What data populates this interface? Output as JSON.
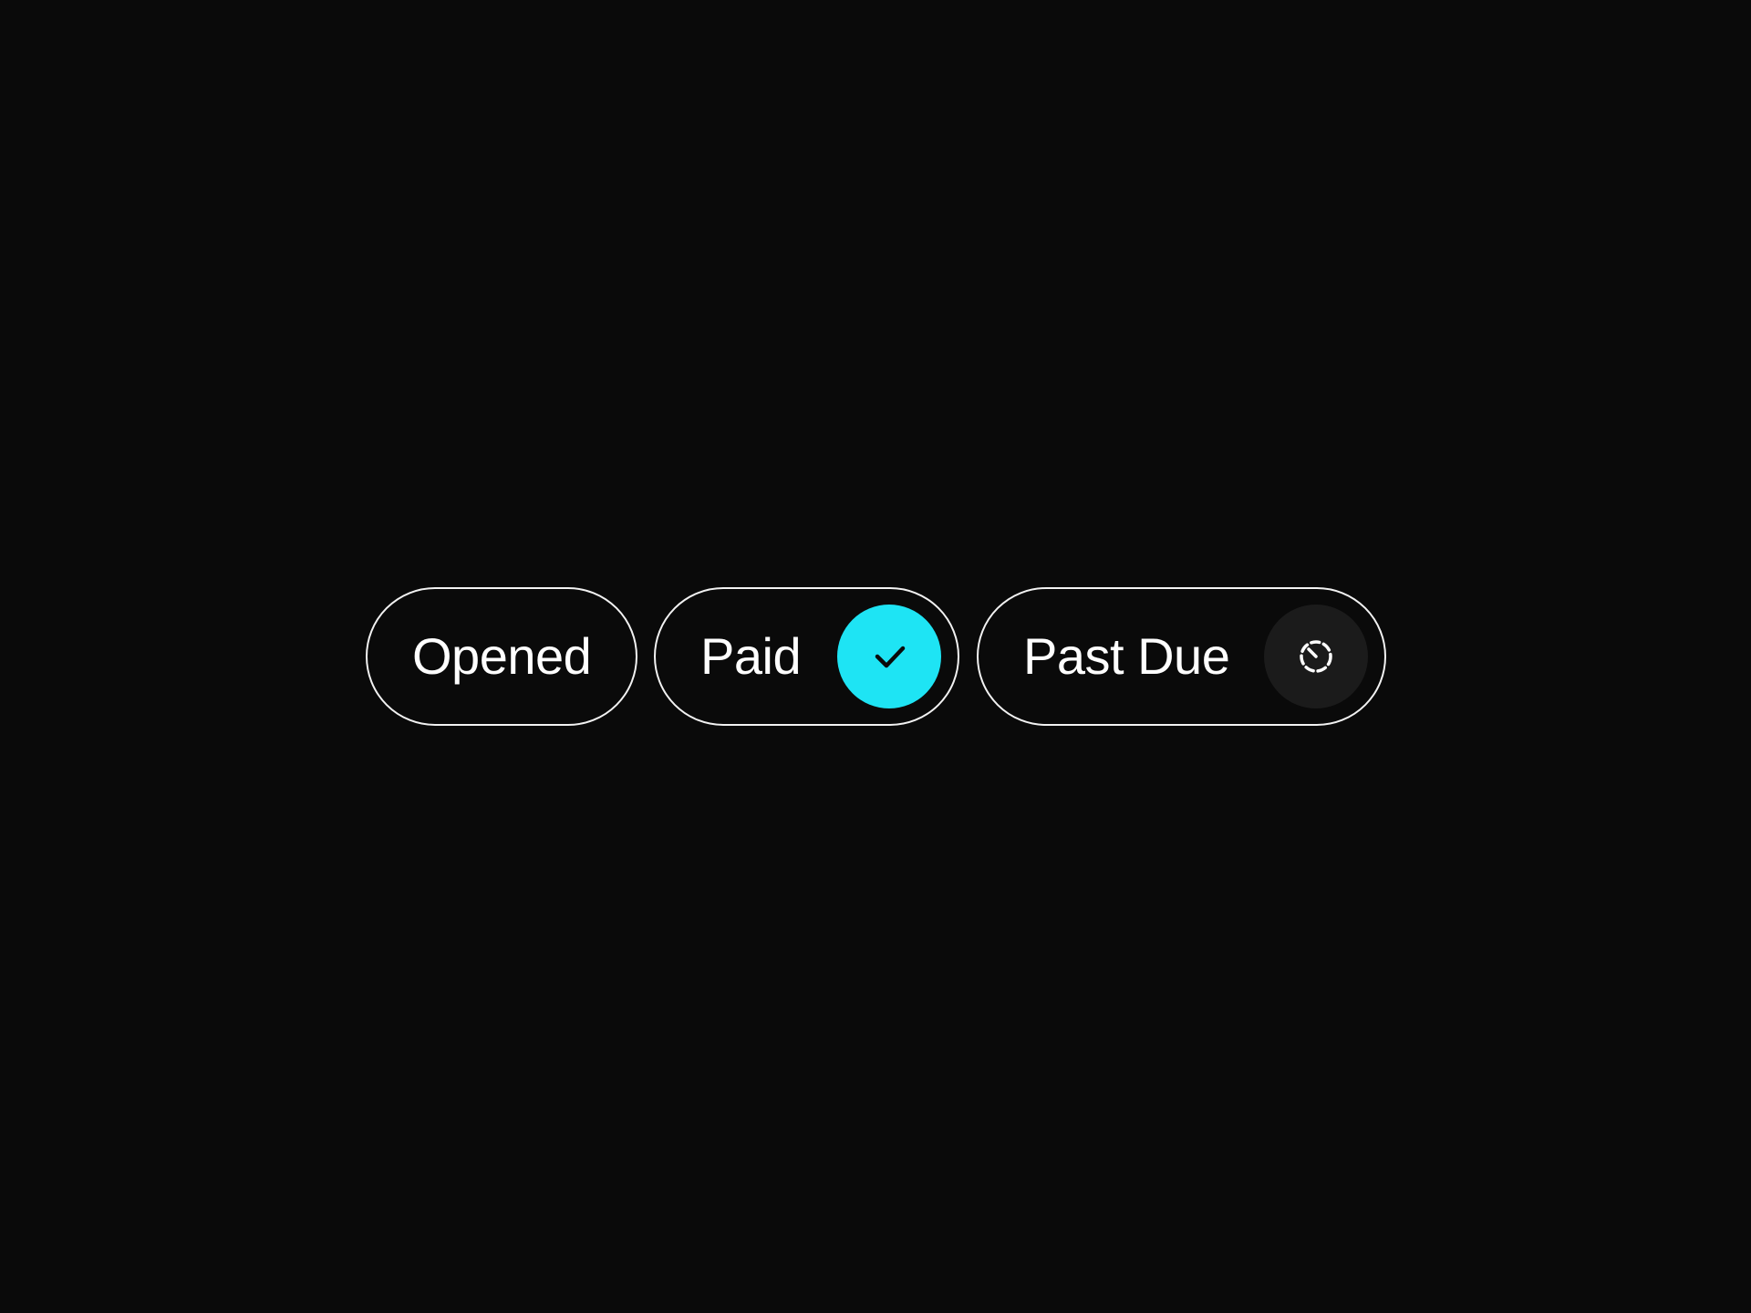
{
  "colors": {
    "background": "#0a0a0a",
    "chip_border": "#f2f2f2",
    "text": "#ffffff",
    "paid_accent": "#1ee4f4",
    "past_due_bg": "#1b1b1b"
  },
  "chips": [
    {
      "label": "Opened",
      "icon": null
    },
    {
      "label": "Paid",
      "icon": "check-icon"
    },
    {
      "label": "Past Due",
      "icon": "dashed-clock-icon"
    }
  ]
}
